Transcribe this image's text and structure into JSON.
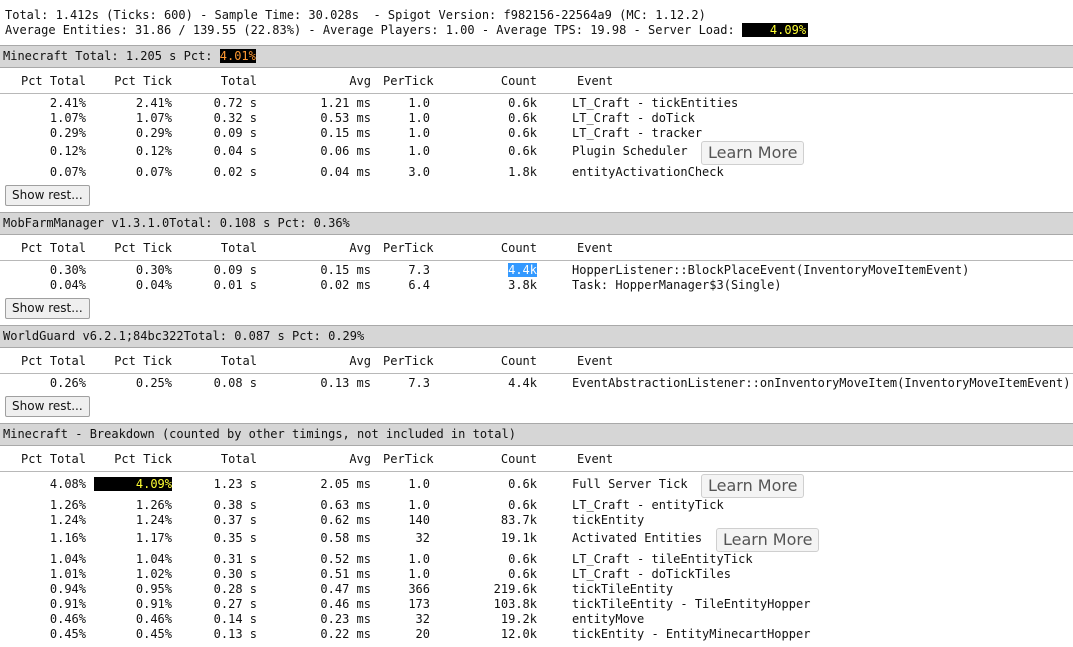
{
  "summary": {
    "line1": "Total: 1.412s (Ticks: 600) - Sample Time: 30.028s  - Spigot Version: f982156-22564a9 (MC: 1.12.2)",
    "line2": "Average Entities: 31.86 / 139.55 (22.83%) - Average Players: 1.00 - Average TPS: 19.98 - Server Load: ",
    "server_load": "4.09%"
  },
  "columns": [
    "Pct Total",
    "Pct Tick",
    "Total",
    "Avg",
    "PerTick",
    "Count",
    "Event"
  ],
  "show_rest_label": "Show rest...",
  "learn_more_label": "Learn More",
  "sections": [
    {
      "title": "Minecraft Total: 1.205 s Pct: ",
      "pct": "4.01%",
      "rows": [
        [
          "2.41%",
          "2.41%",
          "0.72 s",
          "1.21 ms",
          "1.0",
          "0.6k",
          "LT_Craft - tickEntities"
        ],
        [
          "1.07%",
          "1.07%",
          "0.32 s",
          "0.53 ms",
          "1.0",
          "0.6k",
          "LT_Craft - doTick"
        ],
        [
          "0.29%",
          "0.29%",
          "0.09 s",
          "0.15 ms",
          "1.0",
          "0.6k",
          "LT_Craft - tracker"
        ],
        [
          "0.12%",
          "0.12%",
          "0.04 s",
          "0.06 ms",
          "1.0",
          "0.6k",
          "Plugin Scheduler"
        ],
        [
          "0.07%",
          "0.07%",
          "0.02 s",
          "0.04 ms",
          "3.0",
          "1.8k",
          "entityActivationCheck"
        ]
      ]
    },
    {
      "title": "MobFarmManager v1.3.1.0Total: 0.108 s Pct: 0.36%",
      "rows": [
        [
          "0.30%",
          "0.30%",
          "0.09 s",
          "0.15 ms",
          "7.3",
          "4.4k",
          "HopperListener::BlockPlaceEvent(InventoryMoveItemEvent)"
        ],
        [
          "0.04%",
          "0.04%",
          "0.01 s",
          "0.02 ms",
          "6.4",
          "3.8k",
          "Task: HopperManager$3(Single)"
        ]
      ]
    },
    {
      "title": "WorldGuard v6.2.1;84bc322Total: 0.087 s Pct: 0.29%",
      "rows": [
        [
          "0.26%",
          "0.25%",
          "0.08 s",
          "0.13 ms",
          "7.3",
          "4.4k",
          "EventAbstractionListener::onInventoryMoveItem(InventoryMoveItemEvent)"
        ]
      ]
    },
    {
      "title": "Minecraft - Breakdown (counted by other timings, not included in total)",
      "rows": [
        [
          "4.08%",
          "4.09%",
          "1.23 s",
          "2.05 ms",
          "1.0",
          "0.6k",
          "Full Server Tick"
        ],
        [
          "1.26%",
          "1.26%",
          "0.38 s",
          "0.63 ms",
          "1.0",
          "0.6k",
          "LT_Craft - entityTick"
        ],
        [
          "1.24%",
          "1.24%",
          "0.37 s",
          "0.62 ms",
          "140",
          "83.7k",
          "tickEntity"
        ],
        [
          "1.16%",
          "1.17%",
          "0.35 s",
          "0.58 ms",
          "32",
          "19.1k",
          "Activated Entities"
        ],
        [
          "1.04%",
          "1.04%",
          "0.31 s",
          "0.52 ms",
          "1.0",
          "0.6k",
          "LT_Craft - tileEntityTick"
        ],
        [
          "1.01%",
          "1.02%",
          "0.30 s",
          "0.51 ms",
          "1.0",
          "0.6k",
          "LT_Craft - doTickTiles"
        ],
        [
          "0.94%",
          "0.95%",
          "0.28 s",
          "0.47 ms",
          "366",
          "219.6k",
          "tickTileEntity"
        ],
        [
          "0.91%",
          "0.91%",
          "0.27 s",
          "0.46 ms",
          "173",
          "103.8k",
          "tickTileEntity - TileEntityHopper"
        ],
        [
          "0.46%",
          "0.46%",
          "0.14 s",
          "0.23 ms",
          "32",
          "19.2k",
          "entityMove"
        ],
        [
          "0.45%",
          "0.45%",
          "0.13 s",
          "0.22 ms",
          "20",
          "12.0k",
          "tickEntity - EntityMinecartHopper"
        ]
      ]
    }
  ]
}
